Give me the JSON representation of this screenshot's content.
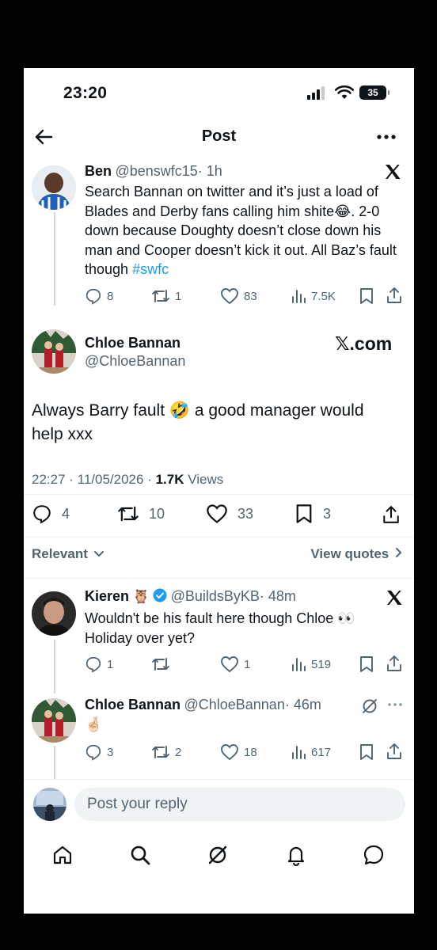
{
  "status_bar": {
    "time": "23:20",
    "battery": "35"
  },
  "header": {
    "title": "Post"
  },
  "quoted_tweet": {
    "name": "Ben",
    "handle": "@benswfc15",
    "time": "· 1h",
    "text_before": "Search Bannan on twitter and it’s just a load of Blades and Derby fans calling him shite😂. 2-0 down because Doughty doesn’t close down his man and Cooper doesn’t kick it out. All Baz’s fault though ",
    "hashtag": "#swfc",
    "stats": {
      "replies": "8",
      "reposts": "1",
      "likes": "83",
      "views": "7.5K"
    }
  },
  "main_post": {
    "name": "Chloe Bannan",
    "handle": "@ChloeBannan",
    "watermark": "𝕏.com",
    "text": "Always Barry fault 🤣 a good manager would help xxx",
    "time": "22:27 · 11/05/2026 · ",
    "views_count": "1.7K",
    "views_label": " Views",
    "stats": {
      "replies": "4",
      "reposts": "10",
      "likes": "33",
      "bookmarks": "3"
    }
  },
  "filters": {
    "relevant": "Relevant",
    "view_quotes": "View quotes"
  },
  "replies": [
    {
      "name": "Kieren",
      "owl": "🦉",
      "handle": "@BuildsByKB",
      "time": "· 48m",
      "line1": "Wouldn't be his fault here though Chloe 👀",
      "line2": "Holiday over yet?",
      "stats": {
        "replies": "1",
        "reposts": "",
        "likes": "1",
        "views": "519"
      }
    },
    {
      "name": "Chloe Bannan",
      "handle": "@ChloeBannan",
      "time": "· 46m",
      "text": "🤞🏻",
      "stats": {
        "replies": "3",
        "reposts": "2",
        "likes": "18",
        "views": "617"
      }
    }
  ],
  "reply_box": {
    "placeholder": "Post your reply"
  },
  "colors": {
    "accent": "#1d9bf0",
    "muted": "#536471",
    "text": "#0f1419"
  }
}
